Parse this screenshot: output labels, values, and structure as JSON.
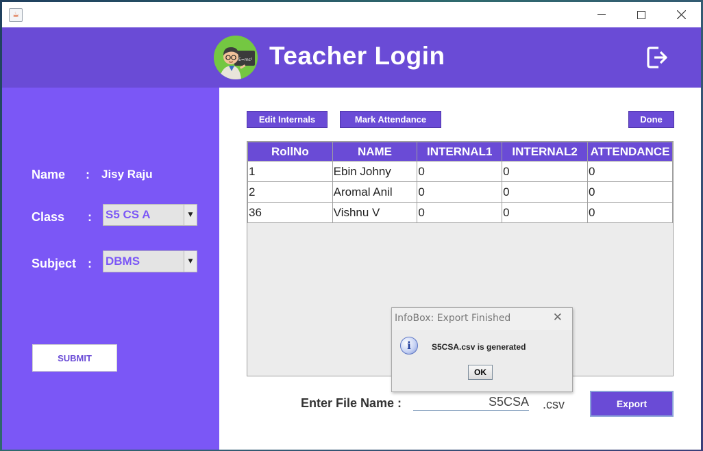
{
  "header": {
    "title": "Teacher Login"
  },
  "teacher": {
    "name_label": "Name",
    "name_sep": ":",
    "name_value": "Jisy Raju",
    "class_label": "Class",
    "class_sep": ":",
    "class_value": "S5 CS A",
    "subject_label": "Subject",
    "subject_sep": ":",
    "subject_value": "DBMS",
    "submit_label": "SUBMIT"
  },
  "toolbar": {
    "edit_internals": "Edit Internals",
    "mark_attendance": "Mark Attendance",
    "done": "Done"
  },
  "table": {
    "columns": [
      "RollNo",
      "NAME",
      "INTERNAL1",
      "INTERNAL2",
      "ATTENDANCE"
    ],
    "rows": [
      [
        "1",
        "Ebin Johny",
        "0",
        "0",
        "0"
      ],
      [
        "2",
        "Aromal Anil",
        "0",
        "0",
        "0"
      ],
      [
        "36",
        "Vishnu V",
        "0",
        "0",
        "0"
      ]
    ]
  },
  "dialog": {
    "title": "InfoBox: Export Finished",
    "message": "S5CSA.csv is generated",
    "ok_label": "OK"
  },
  "export": {
    "file_label": "Enter File Name :",
    "file_value": "S5CSA",
    "extension": ".csv",
    "button_label": "Export"
  },
  "colors": {
    "accent": "#6a4bd6",
    "sidebar": "#7b57f6"
  },
  "icons": {
    "app": "java-icon",
    "logout": "logout-icon",
    "info": "info-icon"
  }
}
